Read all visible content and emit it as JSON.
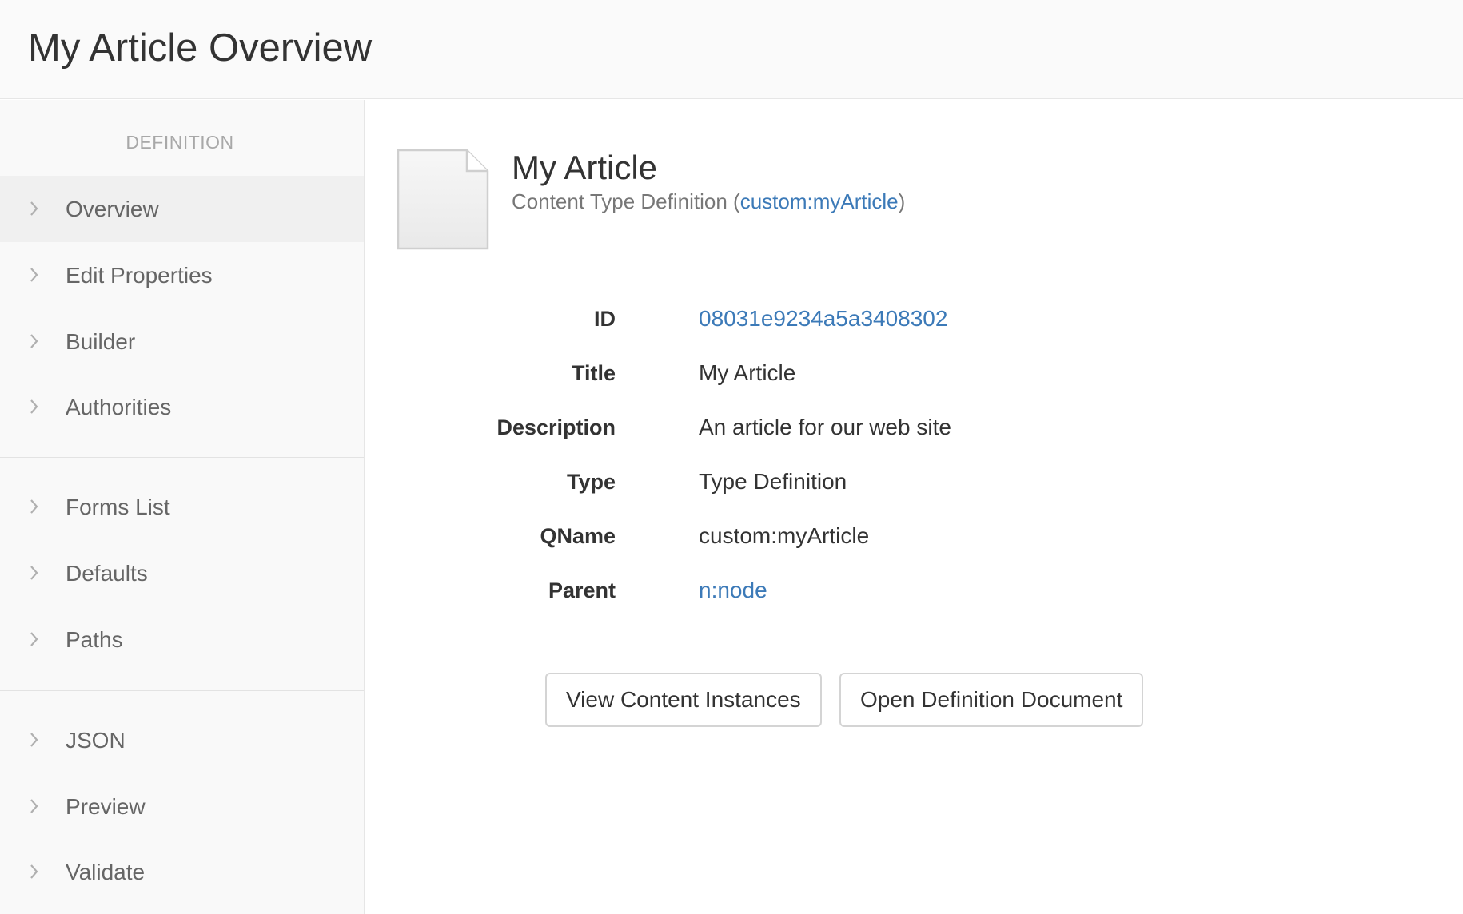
{
  "header": {
    "title": "My Article Overview"
  },
  "sidebar": {
    "heading": "DEFINITION",
    "groups": [
      [
        {
          "label": "Overview",
          "active": true
        },
        {
          "label": "Edit Properties"
        },
        {
          "label": "Builder"
        },
        {
          "label": "Authorities"
        }
      ],
      [
        {
          "label": "Forms List"
        },
        {
          "label": "Defaults"
        },
        {
          "label": "Paths"
        }
      ],
      [
        {
          "label": "JSON"
        },
        {
          "label": "Preview"
        },
        {
          "label": "Validate"
        }
      ]
    ]
  },
  "item": {
    "title": "My Article",
    "subtitle_prefix": "Content Type Definition (",
    "subtitle_link": "custom:myArticle",
    "subtitle_suffix": ")",
    "icon": "document-icon"
  },
  "properties": [
    {
      "label": "ID",
      "value": "08031e9234a5a3408302",
      "link": true
    },
    {
      "label": "Title",
      "value": "My Article",
      "link": false
    },
    {
      "label": "Description",
      "value": "An article for our web site",
      "link": false
    },
    {
      "label": "Type",
      "value": "Type Definition",
      "link": false
    },
    {
      "label": "QName",
      "value": "custom:myArticle",
      "link": false
    },
    {
      "label": "Parent",
      "value": "n:node",
      "link": true
    }
  ],
  "actions": {
    "view_instances": "View Content Instances",
    "open_definition": "Open Definition Document"
  },
  "colors": {
    "link": "#3c7ab8",
    "sidebar_bg": "#f9f9f9",
    "active_bg": "#f0f0f0"
  }
}
